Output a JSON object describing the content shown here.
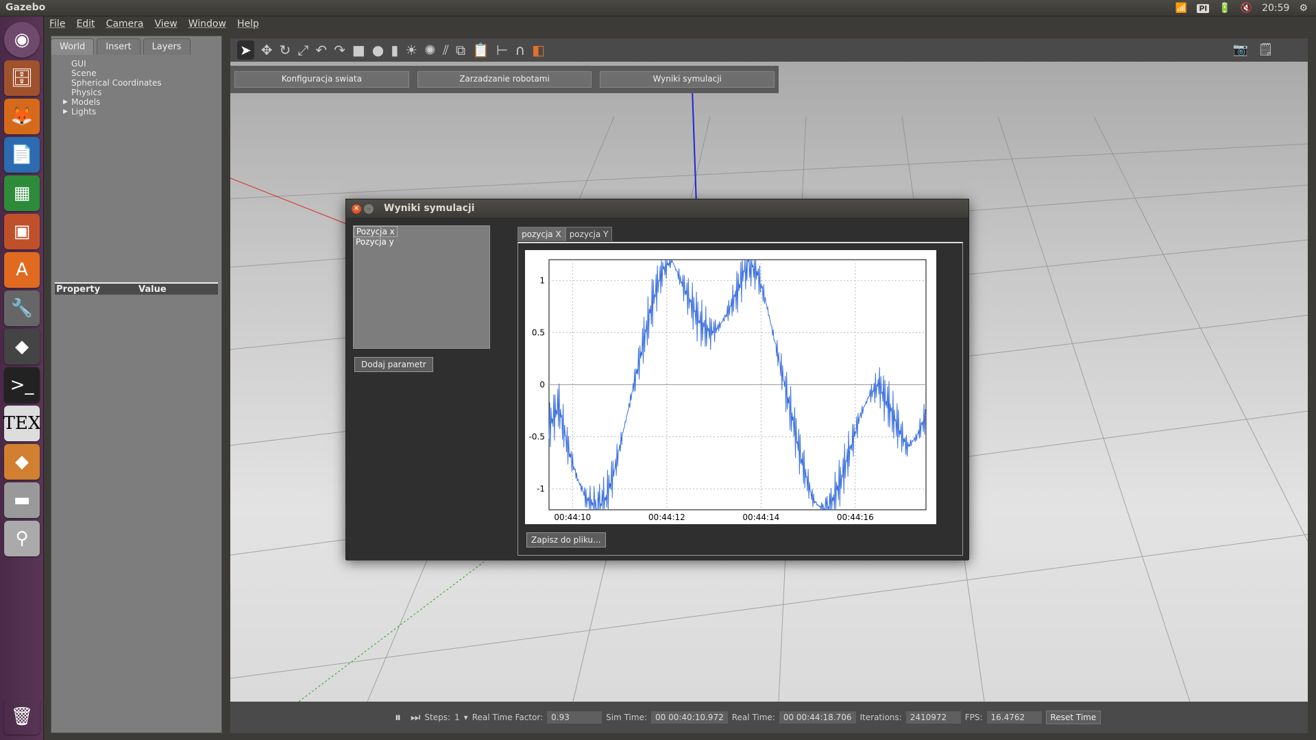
{
  "app_title": "Gazebo",
  "tray": {
    "keyboard": "Pl",
    "time": "20:59"
  },
  "menu": [
    "File",
    "Edit",
    "Camera",
    "View",
    "Window",
    "Help"
  ],
  "left_tabs": [
    "World",
    "Insert",
    "Layers"
  ],
  "tree": [
    "GUI",
    "Scene",
    "Spherical Coordinates",
    "Physics",
    "Models",
    "Lights"
  ],
  "properties": {
    "col1": "Property",
    "col2": "Value"
  },
  "top_buttons": [
    "Konfiguracja swiata",
    "Zarzadzanie robotami",
    "Wyniki symulacji"
  ],
  "bottom": {
    "steps_label": "Steps:",
    "steps_value": "1",
    "rtf_label": "Real Time Factor:",
    "rtf_value": "0.93",
    "sim_label": "Sim Time:",
    "sim_value": "00 00:40:10.972",
    "real_label": "Real Time:",
    "real_value": "00 00:44:18.706",
    "iter_label": "Iterations:",
    "iter_value": "2410972",
    "fps_label": "FPS:",
    "fps_value": "16.4762",
    "reset_label": "Reset Time"
  },
  "dialog": {
    "title": "Wyniki symulacji",
    "params": [
      "Pozycja x",
      "Pozycja y"
    ],
    "add_button": "Dodaj parametr",
    "tabs": [
      "pozycja X",
      "pozycja Y"
    ],
    "save_button": "Zapisz do pliku..."
  },
  "chart_data": {
    "type": "line",
    "title": "",
    "xlabel": "",
    "ylabel": "",
    "ylim": [
      -1.2,
      1.2
    ],
    "yticks": [
      1,
      0.5,
      0,
      -0.5,
      -1
    ],
    "xticks": [
      "00:44:10",
      "00:44:12",
      "00:44:14",
      "00:44:16"
    ],
    "xlim_sec": [
      9.5,
      17.5
    ],
    "grid": true,
    "series": [
      {
        "color": "#3a6fe0",
        "x": [
          9.5,
          9.7,
          9.9,
          10.1,
          10.3,
          10.5,
          10.7,
          10.9,
          11.1,
          11.3,
          11.5,
          11.7,
          11.9,
          12.1,
          12.3,
          12.5,
          12.7,
          12.9,
          13.1,
          13.3,
          13.5,
          13.7,
          13.9,
          14.1,
          14.3,
          14.5,
          14.7,
          14.9,
          15.1,
          15.3,
          15.5,
          15.7,
          15.9,
          16.1,
          16.3,
          16.5,
          16.7,
          16.9,
          17.1,
          17.3,
          17.5
        ],
        "y": [
          -0.4,
          -0.2,
          -0.6,
          -0.9,
          -1.1,
          -1.2,
          -1.1,
          -0.8,
          -0.4,
          0.0,
          0.4,
          0.8,
          1.1,
          1.2,
          1.0,
          0.8,
          0.6,
          0.5,
          0.55,
          0.7,
          0.9,
          1.2,
          1.1,
          0.8,
          0.4,
          0.0,
          -0.4,
          -0.8,
          -1.1,
          -1.2,
          -1.15,
          -0.9,
          -0.6,
          -0.3,
          -0.1,
          0.0,
          -0.2,
          -0.4,
          -0.6,
          -0.5,
          -0.3
        ]
      }
    ]
  }
}
